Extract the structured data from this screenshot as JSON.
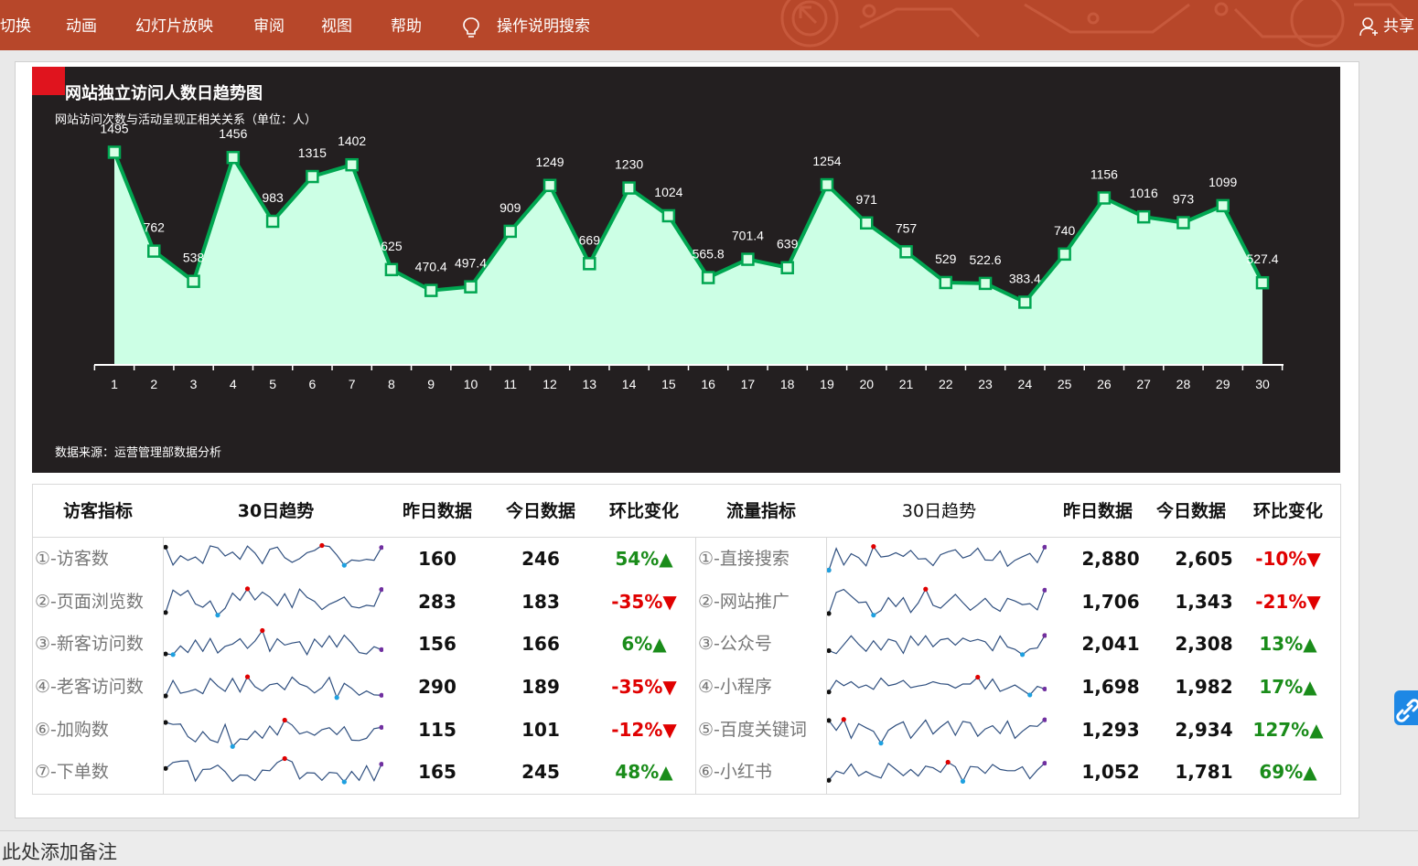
{
  "ribbon": {
    "tabs": [
      "切换",
      "动画",
      "幻灯片放映",
      "审阅",
      "视图",
      "帮助"
    ],
    "search_label": "操作说明搜索",
    "share_label": "共享"
  },
  "chart_data": {
    "type": "area",
    "title": "网站独立访问人数日趋势图",
    "subtitle": "网站访问次数与活动呈现正相关关系（单位：人）",
    "source": "数据来源：运营管理部数据分析",
    "categories": [
      "1",
      "2",
      "3",
      "4",
      "5",
      "6",
      "7",
      "8",
      "9",
      "10",
      "11",
      "12",
      "13",
      "14",
      "15",
      "16",
      "17",
      "18",
      "19",
      "20",
      "21",
      "22",
      "23",
      "24",
      "25",
      "26",
      "27",
      "28",
      "29",
      "30"
    ],
    "values": [
      1495,
      762,
      538,
      1456,
      983,
      1315,
      1402,
      625,
      470.4,
      497.4,
      909,
      1249,
      669,
      1230,
      1024,
      565.8,
      701.4,
      639,
      1254,
      971,
      757,
      529,
      522.6,
      383.4,
      740,
      1156,
      1016,
      973,
      1099,
      527.4
    ],
    "data_labels": [
      "1495",
      "762",
      "538",
      "1456",
      "983",
      "1315",
      "1402",
      "625",
      "470.4",
      "497.4",
      "909",
      "1249",
      "669",
      "1230",
      "1024",
      "565.8",
      "701.4",
      "639",
      "1254",
      "971",
      "757",
      "529",
      "522.6",
      "383.4",
      "740",
      "1156",
      "1016",
      "973",
      "1099",
      "527.4"
    ],
    "colors": {
      "line": "#00a651",
      "fill": "#ccffe5",
      "background": "#231f20",
      "marker_fill": "#d8ffe6",
      "corner": "#e0141e"
    }
  },
  "table": {
    "headers_left": [
      "访客指标",
      "30日趋势",
      "昨日数据",
      "今日数据",
      "环比变化"
    ],
    "headers_right": [
      "流量指标",
      "30日趋势",
      "昨日数据",
      "今日数据",
      "环比变化"
    ],
    "left_rows": [
      {
        "name": "①-访客数",
        "yesterday": "160",
        "today": "246",
        "change": "54%▲",
        "dir": "up",
        "spark": [
          88,
          34,
          62,
          48,
          58,
          39,
          92,
          86,
          61,
          73,
          51,
          91,
          70,
          38,
          81,
          88,
          56,
          42,
          53,
          71,
          78,
          93,
          90,
          64,
          33,
          49,
          46,
          51,
          48,
          87
        ]
      },
      {
        "name": "②-页面浏览数",
        "yesterday": "283",
        "today": "183",
        "change": "-35%▼",
        "dir": "down",
        "spark": [
          20,
          88,
          72,
          87,
          46,
          36,
          55,
          12,
          33,
          79,
          57,
          92,
          58,
          82,
          67,
          41,
          77,
          35,
          91,
          66,
          54,
          29,
          45,
          55,
          67,
          38,
          34,
          42,
          39,
          90
        ]
      },
      {
        "name": "③-新客访问数",
        "yesterday": "156",
        "today": "166",
        "change": "6%▲",
        "dir": "up",
        "spark": [
          22,
          20,
          46,
          26,
          64,
          30,
          69,
          25,
          45,
          52,
          68,
          39,
          61,
          93,
          30,
          68,
          49,
          55,
          59,
          20,
          67,
          43,
          77,
          43,
          79,
          55,
          26,
          22,
          44,
          35
        ]
      },
      {
        "name": "④-老客访问数",
        "yesterday": "290",
        "today": "189",
        "change": "-35%▼",
        "dir": "down",
        "spark": [
          25,
          72,
          33,
          38,
          45,
          32,
          78,
          55,
          39,
          78,
          37,
          83,
          53,
          40,
          59,
          63,
          44,
          82,
          61,
          53,
          34,
          50,
          81,
          20,
          63,
          48,
          27,
          40,
          28,
          27
        ]
      },
      {
        "name": "⑥-加购数",
        "yesterday": "115",
        "today": "101",
        "change": "-12%▼",
        "dir": "down",
        "spark": [
          75,
          69,
          70,
          32,
          16,
          47,
          22,
          14,
          69,
          2,
          25,
          23,
          49,
          27,
          64,
          37,
          82,
          67,
          40,
          47,
          36,
          53,
          59,
          38,
          62,
          21,
          20,
          27,
          56,
          60
        ]
      },
      {
        "name": "⑦-下单数",
        "yesterday": "165",
        "today": "245",
        "change": "48%▲",
        "dir": "up",
        "spark": [
          63,
          81,
          85,
          86,
          25,
          60,
          61,
          73,
          53,
          24,
          43,
          42,
          26,
          58,
          56,
          81,
          93,
          83,
          31,
          50,
          49,
          27,
          51,
          49,
          22,
          54,
          27,
          71,
          26,
          76
        ]
      }
    ],
    "right_rows": [
      {
        "name": "①-直接搜索",
        "yesterday": "2,880",
        "today": "2,605",
        "change": "-10%▼",
        "dir": "down",
        "spark": [
          18,
          84,
          34,
          68,
          56,
          31,
          90,
          58,
          61,
          71,
          60,
          78,
          52,
          53,
          32,
          65,
          74,
          80,
          55,
          63,
          85,
          49,
          48,
          76,
          30,
          48,
          59,
          69,
          41,
          88
        ]
      },
      {
        "name": "②-网站推广",
        "yesterday": "1,706",
        "today": "1,343",
        "change": "-21%▼",
        "dir": "down",
        "spark": [
          17,
          81,
          90,
          70,
          50,
          52,
          12,
          26,
          65,
          38,
          65,
          20,
          49,
          91,
          42,
          33,
          54,
          75,
          50,
          27,
          44,
          63,
          37,
          24,
          63,
          55,
          44,
          47,
          28,
          88
        ]
      },
      {
        "name": "③-公众号",
        "yesterday": "2,041",
        "today": "2,308",
        "change": "13%▲",
        "dir": "up",
        "spark": [
          32,
          23,
          50,
          77,
          51,
          30,
          62,
          34,
          67,
          60,
          24,
          76,
          48,
          77,
          44,
          65,
          69,
          49,
          70,
          60,
          66,
          59,
          32,
          76,
          43,
          36,
          20,
          37,
          40,
          78
        ]
      },
      {
        "name": "④-小程序",
        "yesterday": "1,698",
        "today": "1,982",
        "change": "17%▲",
        "dir": "up",
        "spark": [
          37,
          72,
          56,
          68,
          50,
          58,
          45,
          79,
          56,
          61,
          72,
          50,
          55,
          59,
          68,
          62,
          60,
          49,
          61,
          61,
          82,
          46,
          76,
          39,
          48,
          58,
          43,
          28,
          54,
          46
        ]
      },
      {
        "name": "⑤-百度关键词",
        "yesterday": "1,293",
        "today": "2,934",
        "change": "127%▲",
        "dir": "up",
        "spark": [
          81,
          51,
          84,
          27,
          71,
          59,
          48,
          12,
          51,
          66,
          77,
          27,
          55,
          82,
          40,
          61,
          78,
          36,
          78,
          74,
          33,
          55,
          65,
          41,
          79,
          27,
          48,
          65,
          63,
          83
        ]
      },
      {
        "name": "⑥-小红书",
        "yesterday": "1,052",
        "today": "1,781",
        "change": "69%▲",
        "dir": "up",
        "spark": [
          27,
          55,
          47,
          76,
          40,
          54,
          42,
          34,
          78,
          60,
          41,
          60,
          40,
          70,
          65,
          51,
          82,
          68,
          24,
          69,
          67,
          48,
          75,
          60,
          56,
          56,
          68,
          32,
          58,
          79
        ]
      }
    ]
  },
  "notes": {
    "placeholder": "此处添加备注"
  }
}
